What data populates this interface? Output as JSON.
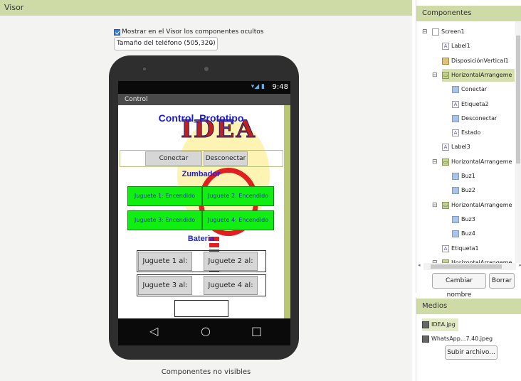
{
  "visor": {
    "title": "Visor",
    "show_hidden_label": "Mostrar en el Visor los componentes ocultos",
    "show_hidden_checked": true,
    "size_select": "Tamaño del teléfono (505,320)",
    "non_visible_label": "Componentes no visibles"
  },
  "phone": {
    "status_time": "9:48",
    "app_title": "Control",
    "screen_title": "Control_Prototipo",
    "logo_text": "IDEA",
    "btn_conectar": "Conectar",
    "btn_desconectar": "Desconectar",
    "label_zumbador": "Zumbador",
    "buz1": "Juguete 1: Encendido",
    "buz2": "Juguete 2: Encendido",
    "buz3": "Juguete 3: Encendido",
    "buz4": "Juguete 4: Encendido",
    "label_bateria": "Bateria",
    "j1": "Juguete 1 al:",
    "j2": "Juguete 2 al:",
    "j3": "Juguete 3 al:",
    "j4": "Juguete 4 al:",
    "nav_back": "◁",
    "nav_home": "○",
    "nav_recent": "□"
  },
  "components": {
    "title": "Componentes",
    "tree": [
      {
        "label": "Screen1",
        "icon": "screen-icon"
      },
      {
        "label": "Label1",
        "icon": "label-icon"
      },
      {
        "label": "DisposiciónVertical1",
        "icon": "vertical-arrangement-icon"
      },
      {
        "label": "HorizontalArrangeme",
        "icon": "horizontal-arrangement-icon"
      },
      {
        "label": "Conectar",
        "icon": "button-icon"
      },
      {
        "label": "Etiqueta2",
        "icon": "label-icon"
      },
      {
        "label": "Desconectar",
        "icon": "button-icon"
      },
      {
        "label": "Estado",
        "icon": "label-icon"
      },
      {
        "label": "Label3",
        "icon": "label-icon"
      },
      {
        "label": "HorizontalArrangeme",
        "icon": "horizontal-arrangement-icon"
      },
      {
        "label": "Buz1",
        "icon": "button-icon"
      },
      {
        "label": "Buz2",
        "icon": "button-icon"
      },
      {
        "label": "HorizontalArrangeme",
        "icon": "horizontal-arrangement-icon"
      },
      {
        "label": "Buz3",
        "icon": "button-icon"
      },
      {
        "label": "Buz4",
        "icon": "button-icon"
      },
      {
        "label": "Etiqueta1",
        "icon": "label-icon"
      },
      {
        "label": "HorizontalArrangeme",
        "icon": "horizontal-arrangement-icon"
      }
    ],
    "rename_button": "Cambiar nombre",
    "delete_button": "Borrar"
  },
  "media": {
    "title": "Medios",
    "files": [
      "IDEA.jpg",
      "WhatsApp...7.40.jpeg"
    ],
    "upload_button": "Subir archivo..."
  },
  "colors": {
    "panel_header": "#cfdba6",
    "green_button": "#11ee11",
    "title_blue": "#1a1add"
  }
}
